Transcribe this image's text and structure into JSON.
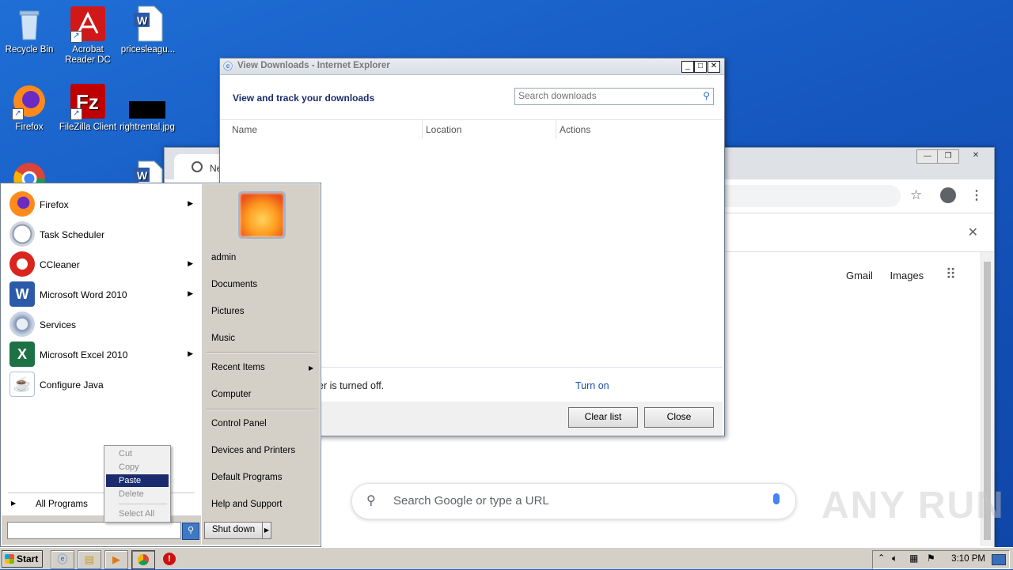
{
  "desktop": {
    "icons": [
      {
        "label": "Recycle Bin"
      },
      {
        "label": "Acrobat Reader DC"
      },
      {
        "label": "pricesleagu..."
      },
      {
        "label": "Firefox"
      },
      {
        "label": "FileZilla Client"
      },
      {
        "label": "rightrental.jpg"
      }
    ]
  },
  "chrome": {
    "tab_label": "New",
    "links": {
      "gmail": "Gmail",
      "images": "Images"
    },
    "search_placeholder": "Search Google or type a URL"
  },
  "downloads": {
    "title": "View Downloads - Internet Explorer",
    "heading": "View and track your downloads",
    "search_placeholder": "Search downloads",
    "columns": [
      "Name",
      "Location",
      "Actions"
    ],
    "info_text": "er is turned off.",
    "turn_on": "Turn on",
    "clear_list": "Clear list",
    "close": "Close"
  },
  "start_menu": {
    "programs": [
      {
        "label": "Firefox",
        "has_submenu": true
      },
      {
        "label": "Task Scheduler",
        "has_submenu": false
      },
      {
        "label": "CCleaner",
        "has_submenu": true
      },
      {
        "label": "Microsoft Word 2010",
        "has_submenu": true
      },
      {
        "label": "Services",
        "has_submenu": false
      },
      {
        "label": "Microsoft Excel 2010",
        "has_submenu": true
      },
      {
        "label": "Configure Java",
        "has_submenu": false
      }
    ],
    "all_programs": "All Programs",
    "right_items": [
      "admin",
      "Documents",
      "Pictures",
      "Music",
      "Recent Items",
      "Computer",
      "Control Panel",
      "Devices and Printers",
      "Default Programs",
      "Help and Support"
    ],
    "shutdown": "Shut down"
  },
  "context_menu": {
    "items": [
      "Cut",
      "Copy",
      "Paste",
      "Delete",
      "Select All"
    ],
    "active": "Paste"
  },
  "taskbar": {
    "start": "Start",
    "clock": "3:10 PM"
  },
  "watermark": "ANY RUN"
}
